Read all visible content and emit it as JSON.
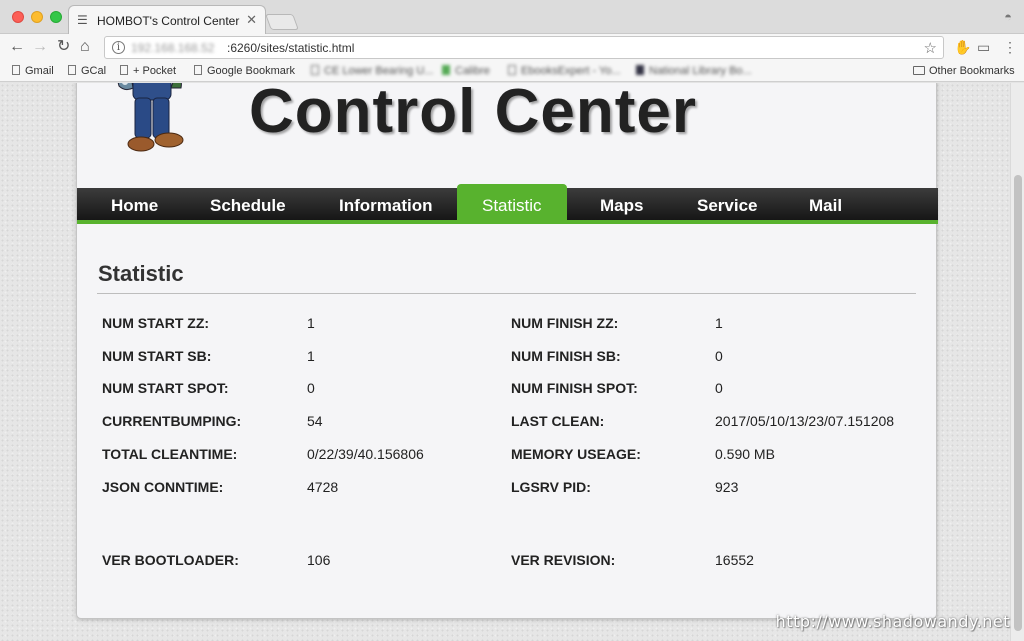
{
  "browser": {
    "tab_title": "HOMBOT's Control Center",
    "url_host": "192.168.168.52",
    "url_path": ":6260/sites/statistic.html",
    "bookmarks": [
      {
        "label": "Gmail"
      },
      {
        "label": "GCal"
      },
      {
        "label": "+ Pocket"
      },
      {
        "label": "Google Bookmark"
      },
      {
        "label": "CE Lower Bearing U..."
      },
      {
        "label": "Calibre"
      },
      {
        "label": "EbooksExpert - Yo..."
      },
      {
        "label": "National Library Bo..."
      }
    ],
    "other_bookmarks": "Other Bookmarks"
  },
  "site": {
    "title": "Control Center",
    "nav": [
      {
        "label": "Home"
      },
      {
        "label": "Schedule"
      },
      {
        "label": "Information"
      },
      {
        "label": "Statistic"
      },
      {
        "label": "Maps"
      },
      {
        "label": "Service"
      },
      {
        "label": "Mail"
      }
    ],
    "active_nav": "Statistic",
    "accent_color": "#58b22e"
  },
  "statistic": {
    "heading": "Statistic",
    "left": [
      {
        "label": "NUM START ZZ:",
        "value": "1"
      },
      {
        "label": "NUM START SB:",
        "value": "1"
      },
      {
        "label": "NUM START SPOT:",
        "value": "0"
      },
      {
        "label": "CURRENTBUMPING:",
        "value": "54"
      },
      {
        "label": "TOTAL CLEANTIME:",
        "value": "0/22/39/40.156806"
      },
      {
        "label": "JSON CONNTIME:",
        "value": "4728"
      },
      {
        "label": "VER BOOTLOADER:",
        "value": "106"
      }
    ],
    "right": [
      {
        "label": "NUM FINISH ZZ:",
        "value": "1"
      },
      {
        "label": "NUM FINISH SB:",
        "value": "0"
      },
      {
        "label": "NUM FINISH SPOT:",
        "value": "0"
      },
      {
        "label": "LAST CLEAN:",
        "value": "2017/05/10/13/23/07.151208"
      },
      {
        "label": "MEMORY USEAGE:",
        "value": "0.590 MB"
      },
      {
        "label": "LGSRV PID:",
        "value": "923"
      },
      {
        "label": "VER REVISION:",
        "value": "16552"
      }
    ]
  },
  "watermark": "http://www.shadowandy.net"
}
